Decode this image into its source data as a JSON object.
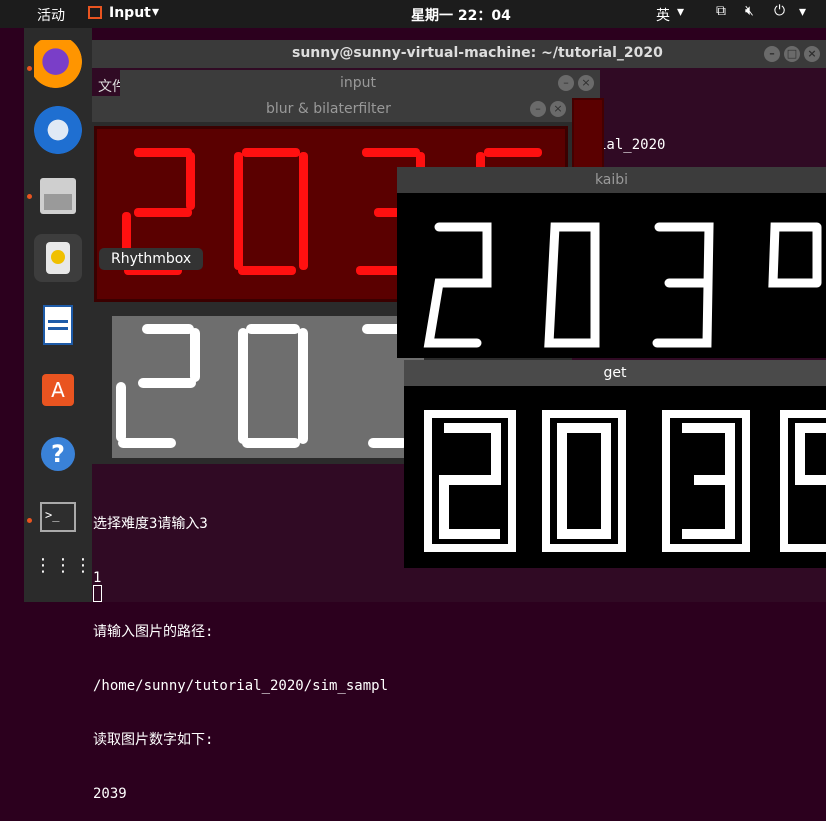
{
  "topbar": {
    "activities": "活动",
    "app_name": "Input",
    "clock": "星期一 22：04",
    "ime": "英"
  },
  "dock": {
    "tooltip": "Rhythmbox"
  },
  "terminal": {
    "title": "sunny@sunny-virtual-machine: ~/tutorial_2020",
    "menu_file": "文件",
    "partial_path": "ial_2020",
    "lines": [
      "选择难度3请输入3",
      "1",
      "请输入图片的路径:",
      "/home/sunny/tutorial_2020/sim_sampl",
      "读取图片数字如下:",
      "2039"
    ]
  },
  "windows": {
    "input": "input",
    "blur": "blur & bilaterfilter",
    "kaibi": "kaibi",
    "get": "get"
  },
  "image_digits": "2039"
}
